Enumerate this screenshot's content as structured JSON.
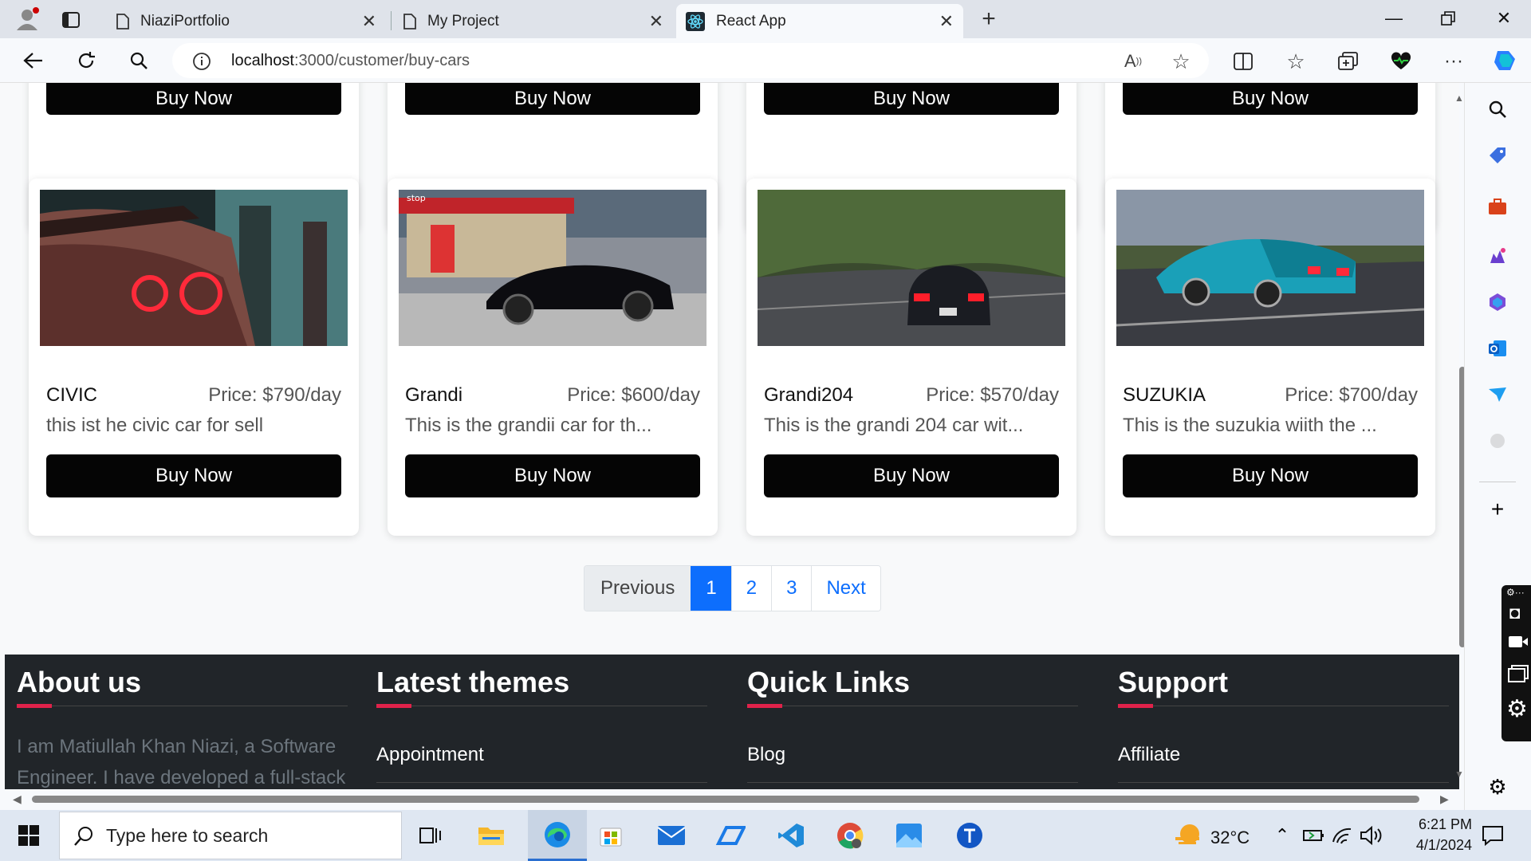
{
  "browser": {
    "tabs": [
      {
        "title": "NiaziPortfolio"
      },
      {
        "title": "My Project"
      },
      {
        "title": "React App"
      }
    ],
    "url_host": "localhost",
    "url_path": ":3000/customer/buy-cars"
  },
  "top_row_buttons": [
    "Buy Now",
    "Buy Now",
    "Buy Now",
    "Buy Now"
  ],
  "cars": [
    {
      "name": "CIVIC",
      "price": "Price: $790/day",
      "description": "this ist he civic car for sell",
      "button": "Buy Now",
      "image_icon": "red-gtr-rear-photo"
    },
    {
      "name": "Grandi",
      "price": "Price: $600/day",
      "description": "This is the grandii car for th...",
      "button": "Buy Now",
      "image_icon": "black-skyline-gas-station-photo"
    },
    {
      "name": "Grandi204",
      "price": "Price: $570/day",
      "description": "This is the grandi 204 car wit...",
      "button": "Buy Now",
      "image_icon": "skyline-forest-road-photo"
    },
    {
      "name": "SUZUKIA",
      "price": "Price: $700/day",
      "description": "This is the suzukia wiith the ...",
      "button": "Buy Now",
      "image_icon": "blue-rx7-highway-photo"
    }
  ],
  "pagination": {
    "previous": "Previous",
    "pages": [
      "1",
      "2",
      "3"
    ],
    "active": "1",
    "next": "Next"
  },
  "footer": {
    "about": {
      "heading": "About us",
      "text": "I am Matiullah Khan Niazi, a Software Engineer. I have developed a full-stack"
    },
    "themes": {
      "heading": "Latest themes",
      "link": "Appointment"
    },
    "quick": {
      "heading": "Quick Links",
      "link": "Blog"
    },
    "support": {
      "heading": "Support",
      "link": "Affiliate"
    }
  },
  "taskbar": {
    "search_placeholder": "Type here to search",
    "weather": "32°C",
    "time": "6:21 PM",
    "date": "4/1/2024"
  },
  "colors": {
    "accent": "#0d6efd",
    "footer_bg": "#212529",
    "underline": "#e0224a",
    "button": "#050505"
  }
}
